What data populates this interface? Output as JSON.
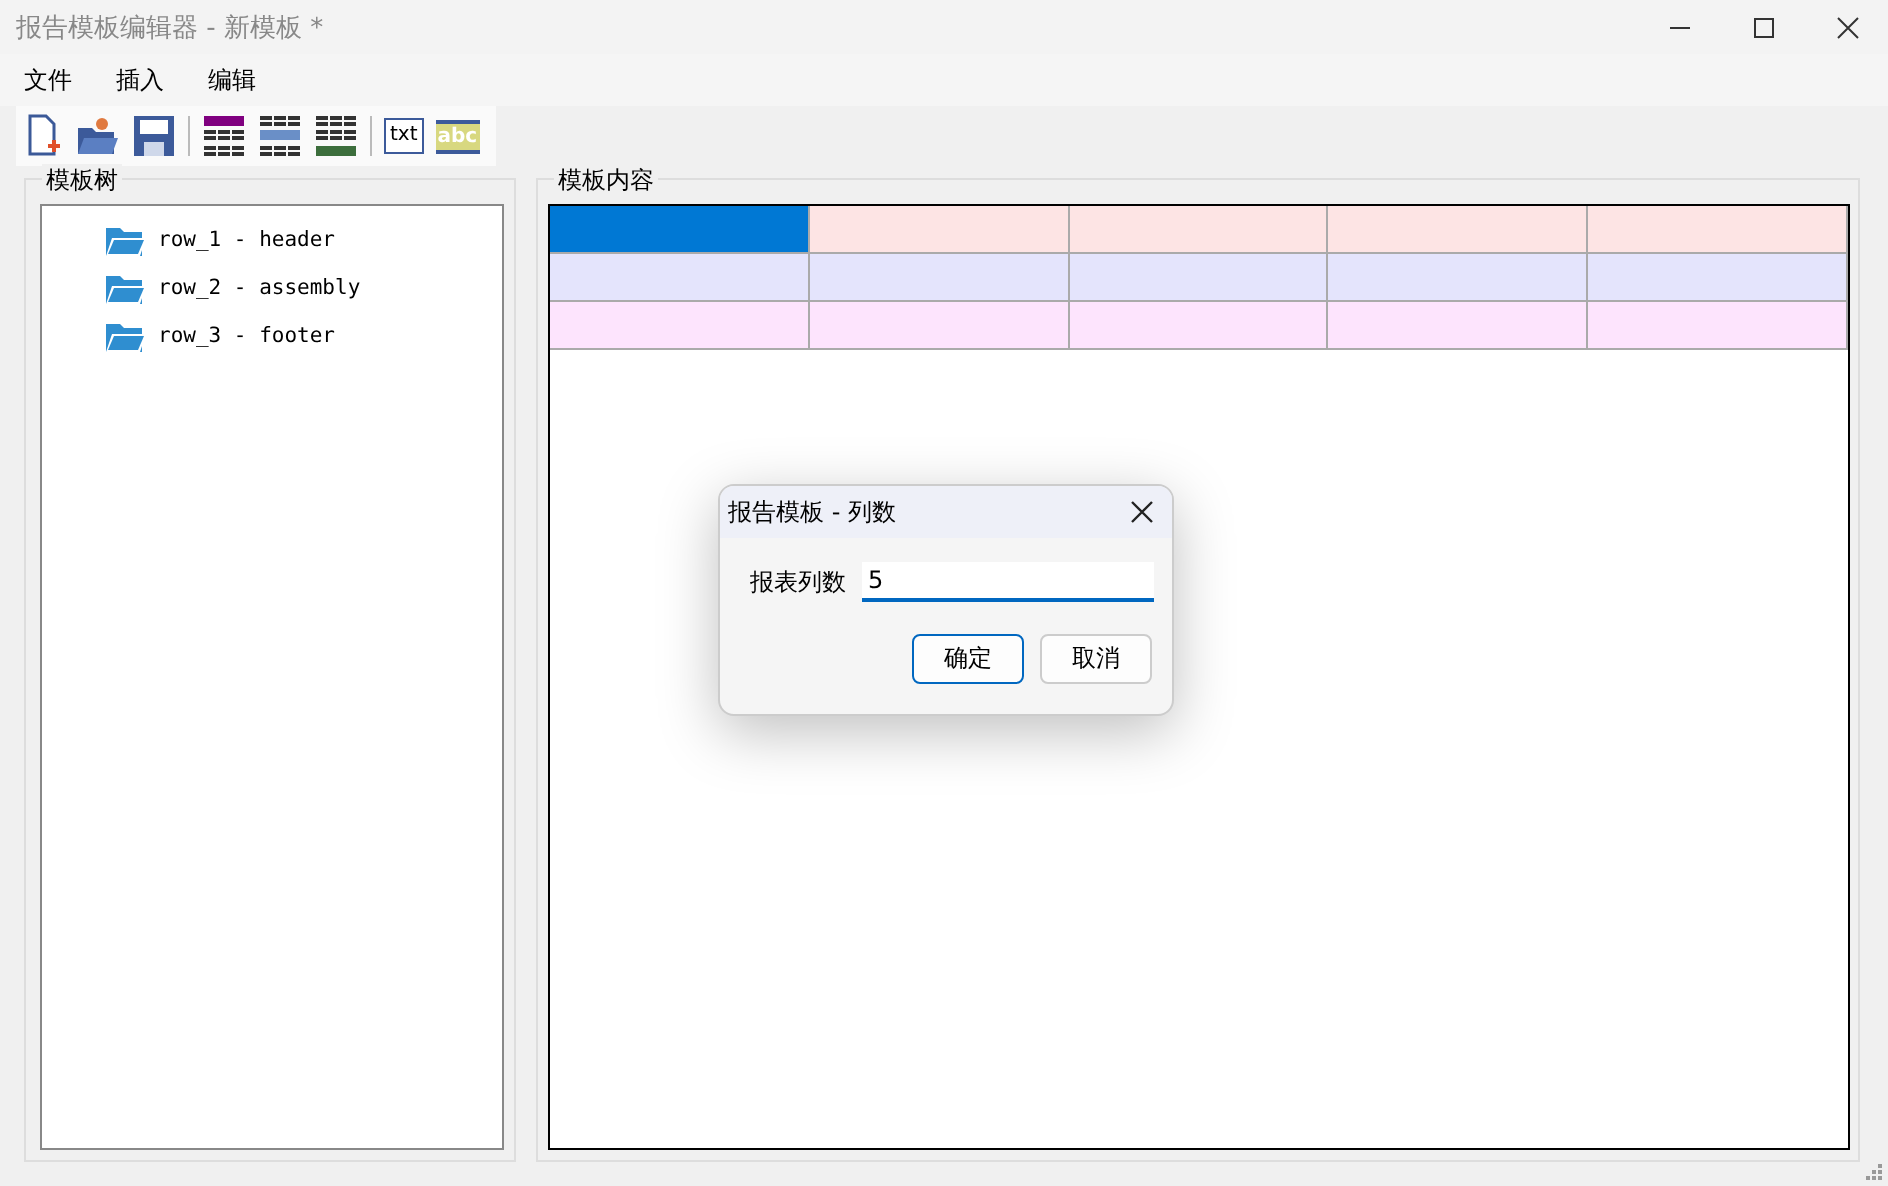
{
  "window": {
    "title": "报告模板编辑器 - 新模板 *"
  },
  "menu": [
    "文件",
    "插入",
    "编辑"
  ],
  "toolbar": [
    {
      "kind": "new"
    },
    {
      "kind": "open"
    },
    {
      "kind": "save"
    },
    {
      "kind": "separator"
    },
    {
      "kind": "table-header"
    },
    {
      "kind": "table-row"
    },
    {
      "kind": "table-footer"
    },
    {
      "kind": "separator"
    },
    {
      "kind": "text",
      "label": "txt"
    },
    {
      "kind": "label",
      "label": "abc"
    }
  ],
  "tree": {
    "title": "模板树",
    "items": [
      {
        "label": "row_1 - header"
      },
      {
        "label": "row_2 - assembly"
      },
      {
        "label": "row_3 - footer"
      }
    ]
  },
  "content": {
    "title": "模板内容",
    "rows": [
      {
        "color": "#fde4e4",
        "cells": [
          {
            "selected": true
          },
          {
            "selected": false
          },
          {
            "selected": false
          },
          {
            "selected": false
          },
          {
            "selected": false
          }
        ]
      },
      {
        "color": "#e4e4fc",
        "cells": [
          {
            "selected": false
          },
          {
            "selected": false
          },
          {
            "selected": false
          },
          {
            "selected": false
          },
          {
            "selected": false
          }
        ]
      },
      {
        "color": "#fde4fd",
        "cells": [
          {
            "selected": false
          },
          {
            "selected": false
          },
          {
            "selected": false
          },
          {
            "selected": false
          },
          {
            "selected": false
          }
        ]
      }
    ]
  },
  "dialog": {
    "title": "报告模板 - 列数",
    "label": "报表列数",
    "value": "5",
    "buttons": [
      "确定",
      "取消"
    ]
  }
}
